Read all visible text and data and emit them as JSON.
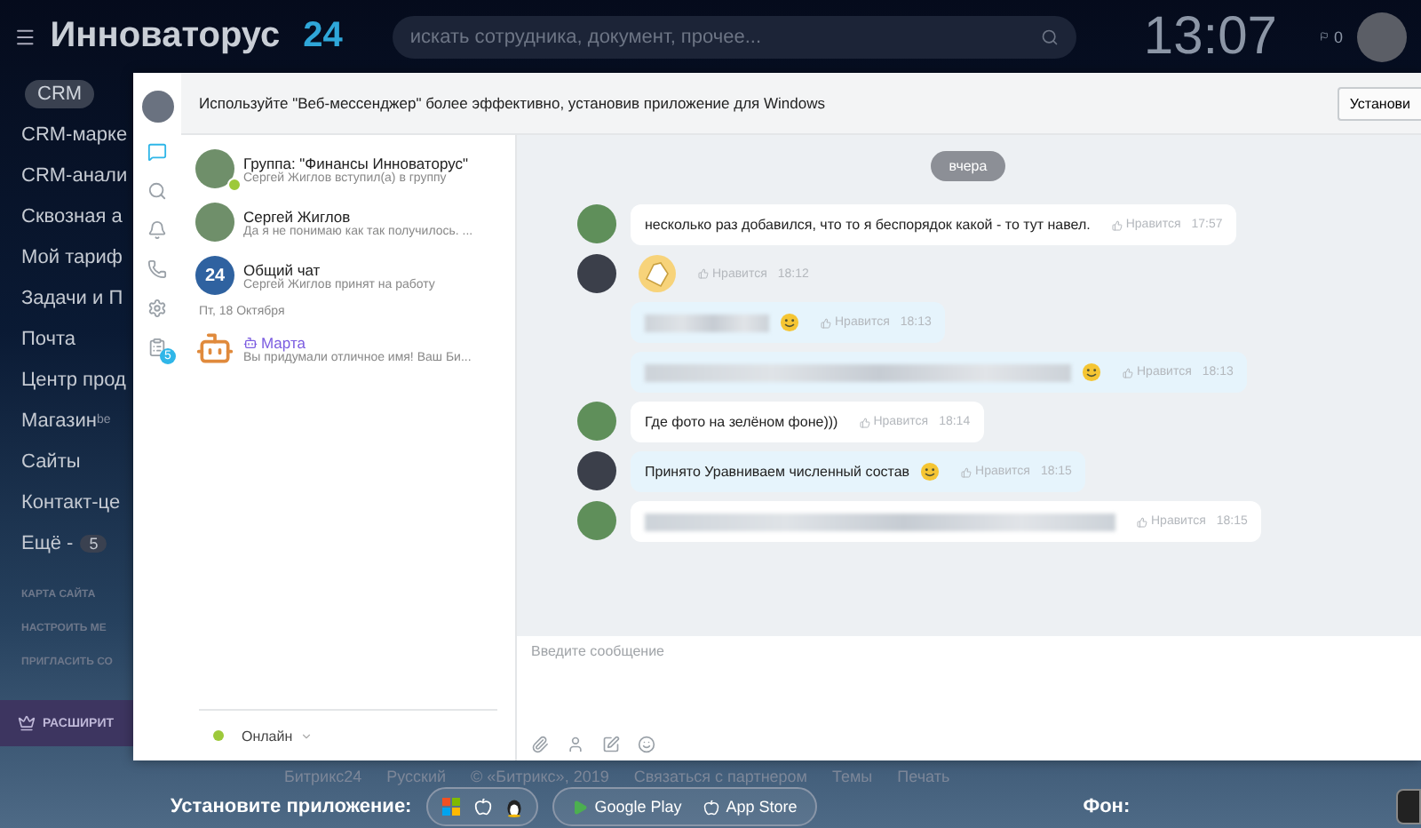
{
  "topbar": {
    "logo": "Инноваторус",
    "logo_suffix": "24",
    "search": {
      "placeholder": "искать сотрудника, документ, прочее..."
    },
    "clock": "13:07",
    "counter": "0"
  },
  "sidebar": {
    "tag": "CRM",
    "items": [
      {
        "label": "CRM-марке"
      },
      {
        "label": "CRM-анали"
      },
      {
        "label": "Сквозная а"
      },
      {
        "label": "Мой тариф"
      },
      {
        "label": "Задачи и П"
      },
      {
        "label": "Почта"
      },
      {
        "label": "Центр прод"
      },
      {
        "label": "Магазин",
        "sup": "be"
      },
      {
        "label": "Сайты"
      },
      {
        "label": "Контакт-це"
      },
      {
        "label": "Ещё -",
        "count": "5"
      }
    ],
    "links": [
      "КАРТА САЙТА",
      "НАСТРОИТЬ МЕ",
      "ПРИГЛАСИТЬ СО"
    ],
    "upgrade": "РАСШИРИТ"
  },
  "messenger": {
    "banner": "Используйте \"Веб-мессенджер\" более эффективно, установив приложение для Windows",
    "install_button": "Установи",
    "nav": [
      {
        "kind": "chat",
        "selected": true
      },
      {
        "kind": "search",
        "selected": false
      },
      {
        "kind": "bell",
        "selected": false
      },
      {
        "kind": "phone",
        "selected": false
      },
      {
        "kind": "gear",
        "selected": false
      },
      {
        "kind": "tasks",
        "selected": false,
        "badge": "5"
      }
    ],
    "recent": [
      {
        "kind": "chat",
        "title": "Группа: \"Финансы Инноваторус\"",
        "subtitle": "Сергей Жиглов вступил(а) в группу",
        "online": true
      },
      {
        "kind": "chat",
        "title": "Сергей Жиглов",
        "subtitle": "Да я не понимаю как так получилось. ...",
        "online": false
      },
      {
        "kind": "chat",
        "avatar_text": "24",
        "title": "Общий чат",
        "subtitle": "Сергей Жиглов принят на работу",
        "online": false
      },
      {
        "kind": "date",
        "title": "Пт, 18 Октября"
      },
      {
        "kind": "bot",
        "title": "Марта",
        "subtitle": "Вы придумали отличное имя! Ваш Би...",
        "online": false
      }
    ],
    "status": "Онлайн",
    "day": "вчера",
    "groups": [
      {
        "outgoing": false,
        "messages": [
          {
            "kind": "text",
            "text": "несколько раз добавился, что то я беспорядок какой - то тут навел.",
            "like": "Нравится",
            "time": "17:57"
          }
        ]
      },
      {
        "outgoing": true,
        "messages": [
          {
            "kind": "sticker",
            "like": "Нравится",
            "time": "18:12"
          },
          {
            "kind": "blurred",
            "emoji": true,
            "like": "Нравится",
            "time": "18:13"
          },
          {
            "kind": "blurred",
            "emoji": true,
            "like": "Нравится",
            "time": "18:13"
          }
        ]
      },
      {
        "outgoing": false,
        "messages": [
          {
            "kind": "text",
            "text": "Где фото на зелёном фоне)))",
            "like": "Нравится",
            "time": "18:14"
          }
        ]
      },
      {
        "outgoing": true,
        "messages": [
          {
            "kind": "text",
            "text": "Принято  Уравниваем численный состав",
            "emoji": true,
            "like": "Нравится",
            "time": "18:15"
          }
        ]
      },
      {
        "outgoing": false,
        "messages": [
          {
            "kind": "blurred",
            "like": "Нравится",
            "time": "18:15"
          }
        ]
      }
    ],
    "input": {
      "placeholder": "Введите сообщение"
    }
  },
  "footer": {
    "links": [
      "Битрикс24",
      "Русский",
      "© «Битрикс», 2019",
      "Связаться с партнером",
      "Темы",
      "Печать"
    ],
    "install_label": "Установите приложение:",
    "stores": [
      "Google Play",
      "App Store"
    ],
    "background_label": "Фон:"
  }
}
